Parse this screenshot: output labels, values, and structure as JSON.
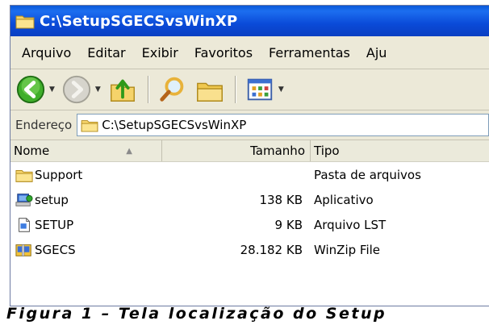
{
  "window": {
    "title": "C:\\SetupSGECSvsWinXP"
  },
  "menubar": {
    "items": [
      "Arquivo",
      "Editar",
      "Exibir",
      "Favoritos",
      "Ferramentas",
      "Aju"
    ]
  },
  "toolbar": {
    "buttons": [
      "back-icon",
      "forward-icon",
      "up-folder-icon",
      "search-icon",
      "folders-icon",
      "views-icon"
    ]
  },
  "addressbar": {
    "label": "Endereço",
    "value": "C:\\SetupSGECSvsWinXP"
  },
  "file_list": {
    "columns": {
      "name": "Nome",
      "size": "Tamanho",
      "type": "Tipo"
    },
    "rows": [
      {
        "name": "Support",
        "size": "",
        "type": "Pasta de arquivos",
        "icon": "folder-icon"
      },
      {
        "name": "setup",
        "size": "138 KB",
        "type": "Aplicativo",
        "icon": "application-icon"
      },
      {
        "name": "SETUP",
        "size": "9 KB",
        "type": "Arquivo LST",
        "icon": "lst-file-icon"
      },
      {
        "name": "SGECS",
        "size": "28.182 KB",
        "type": "WinZip File",
        "icon": "winzip-icon"
      }
    ]
  },
  "caption": "Figura 1 – Tela localização do Setup",
  "colors": {
    "titlebar": "#0a4ad8",
    "chrome": "#ece9d8",
    "folder": "#f5d36a"
  }
}
